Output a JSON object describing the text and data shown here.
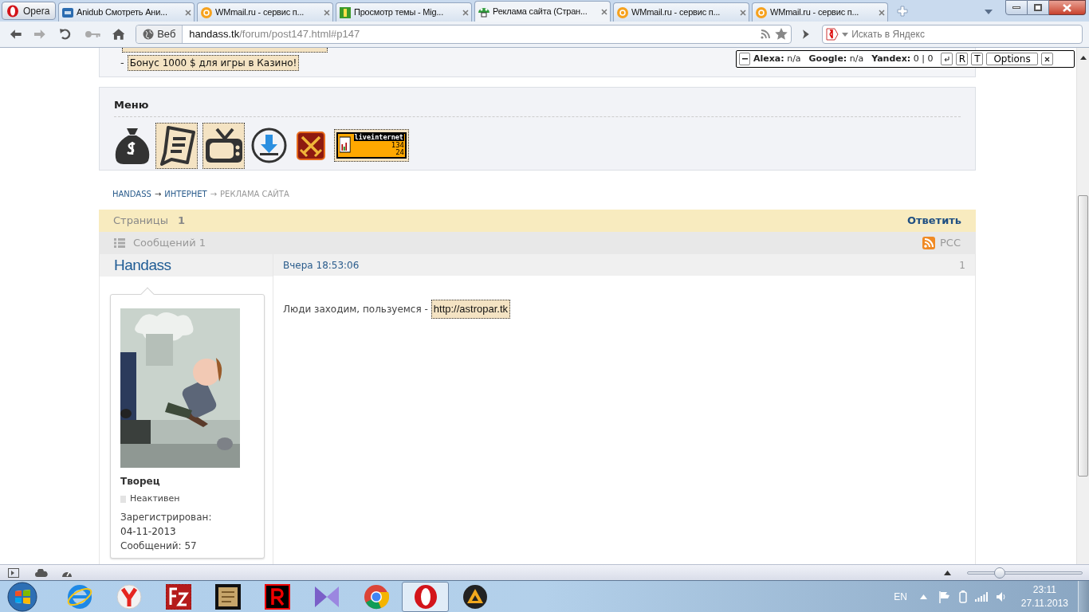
{
  "browser": {
    "menu_button": "Opera",
    "tabs": [
      {
        "title": "Anidub Смотреть Ани...",
        "selected": false
      },
      {
        "title": "WMmail.ru - сервис п...",
        "selected": false
      },
      {
        "title": "Просмотр темы - Mig...",
        "selected": false
      },
      {
        "title": "Реклама сайта (Стран...",
        "selected": true
      },
      {
        "title": "WMmail.ru - сервис п...",
        "selected": false
      },
      {
        "title": "WMmail.ru - сервис п...",
        "selected": false
      }
    ],
    "address": {
      "badge": "Веб",
      "host": "handass.tk",
      "path": "/forum/post147.html#p147"
    },
    "search": {
      "placeholder": "Искать в Яндекс"
    }
  },
  "seo_bar": {
    "items": [
      {
        "label": "Alexa:",
        "value": "n/a"
      },
      {
        "label": "Google:",
        "value": "n/a"
      },
      {
        "label": "Yandex:",
        "value": "0 | 0"
      }
    ],
    "buttons": [
      "R",
      "T",
      "Options"
    ]
  },
  "page": {
    "top_links": [
      {
        "prefix": "-",
        "text": "Бонус 1000 $ для игры в Казино!"
      }
    ],
    "menu": {
      "title": "Меню",
      "counter": {
        "label": "liveinternet",
        "line_1": "134",
        "line_2": "24"
      }
    },
    "breadcrumb": {
      "separator": "→",
      "items": [
        {
          "text": "HANDASS",
          "current": false
        },
        {
          "text": "ИНТЕРНЕТ",
          "current": false
        },
        {
          "text": "РЕКЛАМА САЙТА",
          "current": true
        }
      ]
    },
    "pages": {
      "label": "Страницы",
      "current": "1",
      "reply": "Ответить"
    },
    "messages": {
      "label": "Сообщений 1",
      "rss": "РСС"
    },
    "post": {
      "author": "Handass",
      "date": "Вчера 18:53:06",
      "number": "1",
      "rank": "Творец",
      "status": "Неактивен",
      "online": false,
      "registered_label": "Зарегистрирован:",
      "registered": "04-11-2013",
      "posts": "Сообщений: 57",
      "text": "Люди заходим, пользуемся -",
      "link": "http://astropar.tk"
    }
  },
  "status_bar": {
    "zoom": {
      "level": 0.28
    }
  },
  "taskbar": {
    "apps": [
      {
        "selected": false
      },
      {
        "selected": false
      },
      {
        "selected": false
      },
      {
        "selected": false
      },
      {
        "selected": false
      },
      {
        "selected": false
      },
      {
        "selected": false
      },
      {
        "selected": true
      },
      {
        "selected": false
      }
    ],
    "language": "EN",
    "time": "23:11",
    "date": "27.11.2013"
  }
}
